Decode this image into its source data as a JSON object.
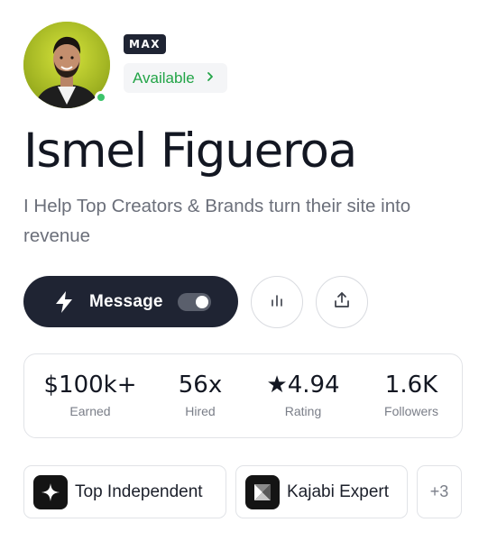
{
  "profile": {
    "name": "Ismel Figueroa",
    "tagline": "I Help Top Creators & Brands turn their site into revenue",
    "tier_badge": "MAX",
    "availability": "Available",
    "availability_color": "#22a447",
    "online": true
  },
  "actions": {
    "message_label": "Message",
    "message_toggle_on": true,
    "stats_icon": "bar-chart-icon",
    "share_icon": "share-icon"
  },
  "stats": [
    {
      "value": "$100k+",
      "label": "Earned"
    },
    {
      "value": "56x",
      "label": "Hired"
    },
    {
      "value": "★4.94",
      "label": "Rating"
    },
    {
      "value": "1.6K",
      "label": "Followers"
    }
  ],
  "badges": [
    {
      "label": "Top Independent",
      "icon": "sparkle-icon"
    },
    {
      "label": "Kajabi Expert",
      "icon": "kajabi-logo-icon"
    }
  ],
  "more_badges": "+3",
  "colors": {
    "primary_dark": "#1f2433",
    "accent_green": "#22a447",
    "online_dot": "#3cc46a",
    "avatar_bg": "#b9cc2c"
  }
}
